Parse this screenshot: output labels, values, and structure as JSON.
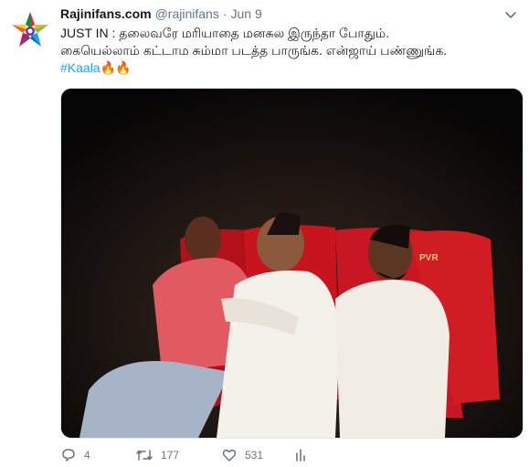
{
  "tweet": {
    "author_name": "Rajinifans.com",
    "handle": "@rajinifans",
    "separator": "·",
    "date": "Jun 9",
    "text_line1": "JUST IN : தலைவரே மரியாதை மனசுல இருந்தா போதும்.",
    "text_line2": "கையெல்லாம் கட்டாம சும்மா படத்த பாருங்க. என்ஜாய் பண்ணுங்க.",
    "hashtag": "#Kaala",
    "emoji": "🔥🔥",
    "image_text": "PVR"
  },
  "actions": {
    "reply_count": "4",
    "retweet_count": "177",
    "like_count": "531"
  },
  "icons": {
    "avatar": "star-logo",
    "menu": "chevron-down-icon",
    "reply": "reply-icon",
    "retweet": "retweet-icon",
    "like": "heart-icon",
    "stats": "analytics-icon"
  },
  "colors": {
    "link": "#1da1f2",
    "secondary_text": "#657786",
    "primary_text": "#14171a"
  }
}
